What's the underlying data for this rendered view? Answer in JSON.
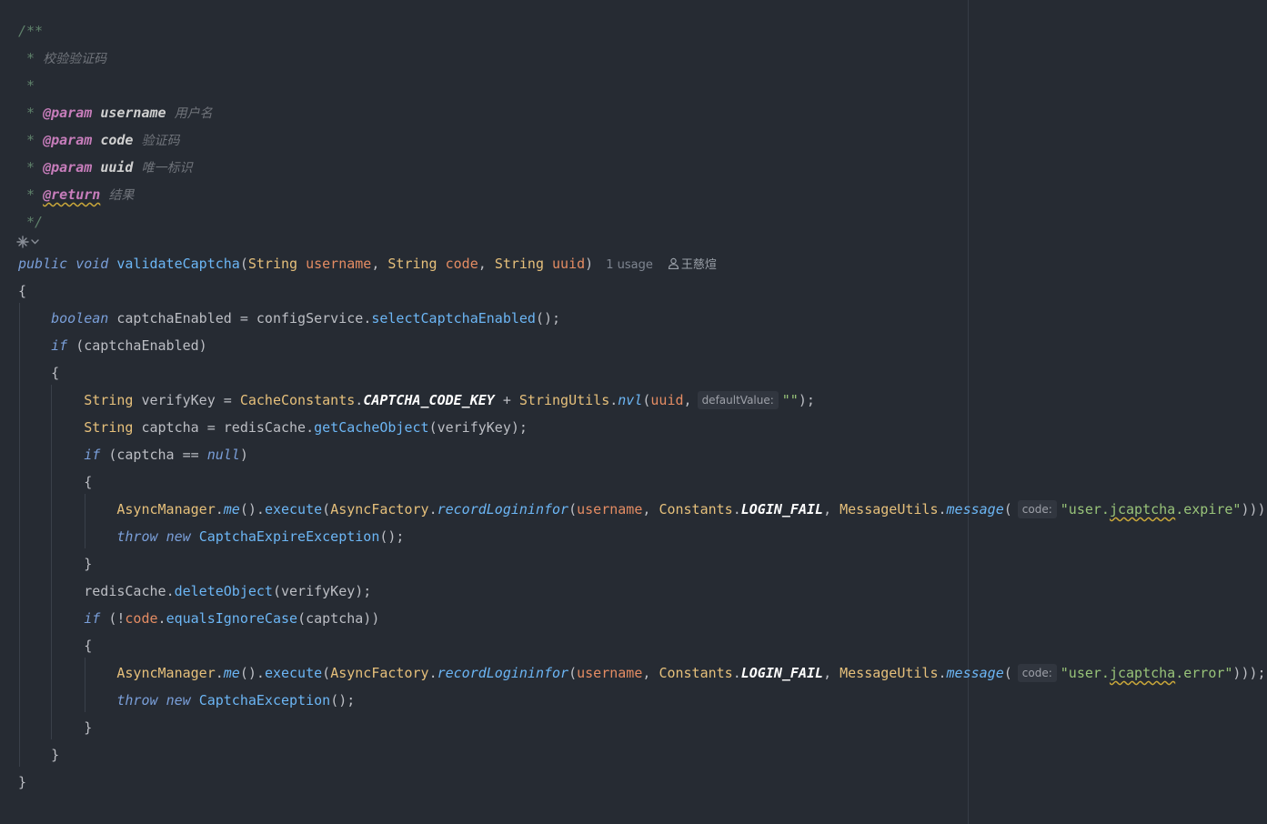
{
  "javadoc": {
    "open": "/**",
    "star": " * ",
    "summary": "校验验证码",
    "blank_star": " *",
    "param_tag": "@param",
    "return_tag": "@return",
    "params": [
      {
        "name": "username",
        "desc": "用户名"
      },
      {
        "name": "code",
        "desc": "验证码"
      },
      {
        "name": "uuid",
        "desc": "唯一标识"
      }
    ],
    "return_desc": "结果",
    "close": " */"
  },
  "gutter": {
    "icon": "ai-sparkle-icon"
  },
  "signature": {
    "modifier": "public",
    "return_type": "void",
    "method_name": "validateCaptcha",
    "open_paren": "(",
    "param_type": "String",
    "p1": "username",
    "p2": "code",
    "p3": "uuid",
    "sep": ", ",
    "close_paren": ")",
    "usages": "1 usage",
    "author": "王慈煊",
    "author_icon": "person-icon"
  },
  "code": {
    "brace_open": "{",
    "brace_close": "}",
    "boolean_kw": "boolean",
    "captcha_enabled": "captchaEnabled",
    "assign": " = ",
    "config_service": "configService",
    "select_captcha_enabled": "selectCaptchaEnabled",
    "call_end": "();",
    "if_kw": "if",
    "captcha_enabled_cond": "(captchaEnabled)",
    "string_type": "String",
    "verify_key": "verifyKey",
    "cache_constants": "CacheConstants",
    "captcha_code_key": "CAPTCHA_CODE_KEY",
    "plus": " + ",
    "string_utils": "StringUtils",
    "nvl": "nvl",
    "uuid": "uuid",
    "hint_default_value": "defaultValue:",
    "empty_string": "\"\"",
    "captcha": "captcha",
    "redis_cache": "redisCache",
    "get_cache_object": "getCacheObject",
    "verify_key_arg": "(verifyKey);",
    "captcha_null_open": "(captcha == ",
    "null_kw": "null",
    "async_manager": "AsyncManager",
    "me": "me",
    "execute": "execute",
    "async_factory": "AsyncFactory",
    "record_logininfor": "recordLogininfor",
    "username": "username",
    "constants": "Constants",
    "login_fail": "LOGIN_FAIL",
    "message_utils": "MessageUtils",
    "message": "message",
    "hint_code": "code:",
    "expire_msg_1": "\"user.",
    "expire_msg_word": "jcaptcha",
    "expire_msg_2": ".expire\"",
    "error_msg_2": ".error\"",
    "triple_close": ")));",
    "throw_kw": "throw",
    "new_kw": "new",
    "captcha_expire_exception": "CaptchaExpireException",
    "delete_object": "deleteObject",
    "not_paren": "(!",
    "code_var": "code",
    "equals_ignore_case": "equalsIgnoreCase",
    "captcha_arg": "(captcha))",
    "captcha_exception": "CaptchaException"
  }
}
